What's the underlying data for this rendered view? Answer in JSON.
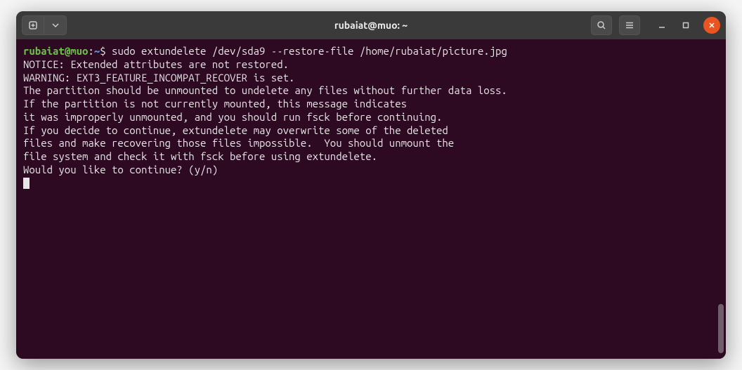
{
  "window": {
    "title": "rubaiat@muo: ~"
  },
  "prompt": {
    "user": "rubaiat",
    "at": "@",
    "host": "muo",
    "colon": ":",
    "path": "~",
    "dollar": "$ "
  },
  "command": "sudo extundelete /dev/sda9 --restore-file /home/rubaiat/picture.jpg",
  "output": {
    "l1": "NOTICE: Extended attributes are not restored.",
    "l2": "WARNING: EXT3_FEATURE_INCOMPAT_RECOVER is set.",
    "l3": "The partition should be unmounted to undelete any files without further data loss.",
    "l4": "If the partition is not currently mounted, this message indicates",
    "l5": "it was improperly unmounted, and you should run fsck before continuing.",
    "l6": "If you decide to continue, extundelete may overwrite some of the deleted",
    "l7": "files and make recovering those files impossible.  You should unmount the",
    "l8": "file system and check it with fsck before using extundelete.",
    "l9": "Would you like to continue? (y/n)"
  }
}
